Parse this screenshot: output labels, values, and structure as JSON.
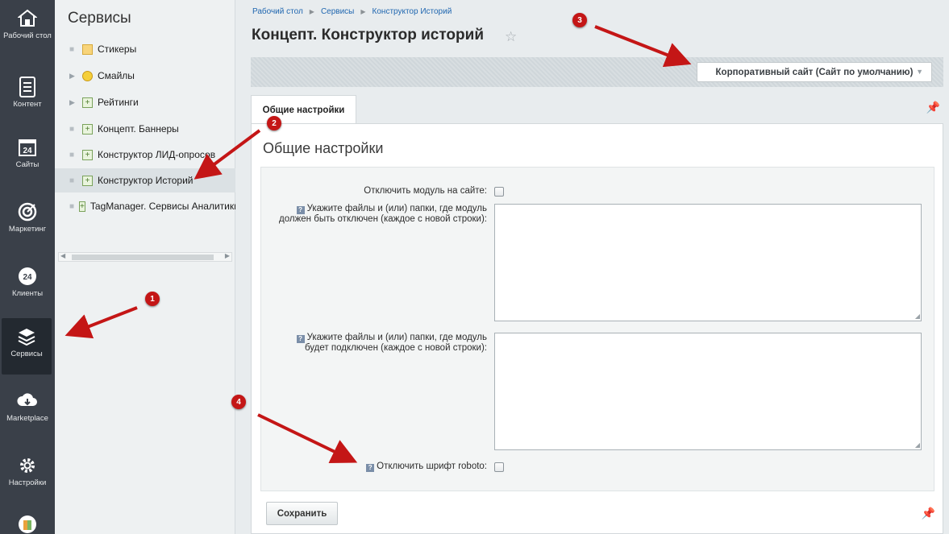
{
  "rail": {
    "items": [
      {
        "label": "Рабочий стол",
        "icon": "home-icon"
      },
      {
        "label": "Контент",
        "icon": "document-icon"
      },
      {
        "label": "Сайты",
        "icon": "calendar-24-icon"
      },
      {
        "label": "Маркетинг",
        "icon": "target-icon"
      },
      {
        "label": "Клиенты",
        "icon": "clients-24-icon"
      },
      {
        "label": "Сервисы",
        "icon": "layers-icon"
      },
      {
        "label": "Marketplace",
        "icon": "cloud-download-icon"
      },
      {
        "label": "Настройки",
        "icon": "gear-icon"
      }
    ]
  },
  "sidebar": {
    "title": "Сервисы",
    "items": [
      {
        "label": "Стикеры"
      },
      {
        "label": "Смайлы"
      },
      {
        "label": "Рейтинги"
      },
      {
        "label": "Концепт. Баннеры"
      },
      {
        "label": "Конструктор ЛИД-опросов"
      },
      {
        "label": "Конструктор Историй"
      },
      {
        "label": "TagManager. Сервисы Аналитики"
      }
    ]
  },
  "breadcrumb": {
    "items": [
      "Рабочий стол",
      "Сервисы",
      "Конструктор Историй"
    ]
  },
  "page": {
    "title": "Концепт. Конструктор историй",
    "site_select": "Корпоративный сайт (Сайт по умолчанию)",
    "tab": "Общие настройки",
    "section_title": "Общие настройки"
  },
  "form": {
    "disable_module_label": "Отключить модуль на сайте:",
    "disable_paths_label_1": "Укажите файлы и (или) папки, где модуль",
    "disable_paths_label_2": "должен быть отключен (каждое с новой строки):",
    "enable_paths_label_1": "Укажите файлы и (или) папки, где модуль",
    "enable_paths_label_2": "будет подключен (каждое с новой строки):",
    "disable_roboto_label": "Отключить шрифт roboto:",
    "save_button": "Сохранить"
  },
  "annotations": {
    "badges": [
      "1",
      "2",
      "3",
      "4"
    ],
    "color": "#c41616"
  },
  "colors": {
    "rail_bg": "#3a4049",
    "link": "#2067b0"
  }
}
